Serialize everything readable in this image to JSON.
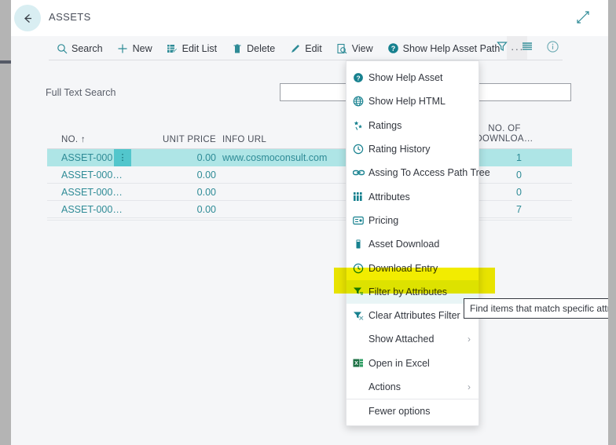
{
  "window": {
    "back_icon": "back-arrow-icon",
    "title": "ASSETS",
    "expand_icon": "expand-diagonal-icon"
  },
  "toolbar": {
    "items": [
      {
        "label": "Search",
        "icon": "search-icon"
      },
      {
        "label": "New",
        "icon": "plus-icon"
      },
      {
        "label": "Edit List",
        "icon": "edit-list-icon"
      },
      {
        "label": "Delete",
        "icon": "trash-icon"
      },
      {
        "label": "Edit",
        "icon": "pencil-icon"
      },
      {
        "label": "View",
        "icon": "view-page-icon"
      },
      {
        "label": "Show Help Asset Path",
        "icon": "help-circle-icon"
      }
    ],
    "ellipsis_label": "···",
    "right_icons": [
      {
        "name": "filter-funnel-icon"
      },
      {
        "name": "list-lines-icon"
      },
      {
        "name": "info-circle-icon"
      }
    ]
  },
  "filter_pane": {
    "full_text_search_label": "Full Text Search",
    "full_text_search_value": "",
    "full_text_search_placeholder": ""
  },
  "grid": {
    "columns": [
      {
        "key": "no",
        "label": "NO. ↑"
      },
      {
        "key": "price",
        "label": "UNIT PRICE"
      },
      {
        "key": "url",
        "label": "INFO URL"
      },
      {
        "key": "dl",
        "label": "NO. OF",
        "label2": "DOWNLOA…"
      }
    ],
    "rows": [
      {
        "no": "ASSET-000…",
        "price": "0.00",
        "url": "www.cosmoconsult.com",
        "dl": "1",
        "selected": true
      },
      {
        "no": "ASSET-000…",
        "price": "0.00",
        "url": "",
        "dl": "0",
        "selected": false
      },
      {
        "no": "ASSET-000…",
        "price": "0.00",
        "url": "",
        "dl": "0",
        "selected": false
      },
      {
        "no": "ASSET-000…",
        "price": "0.00",
        "url": "",
        "dl": "7",
        "selected": false
      }
    ],
    "row_menu_label": "⋮"
  },
  "menu": {
    "items": [
      {
        "label": "Show Help Asset",
        "icon": "help-circle-icon",
        "submenu": false,
        "hovered": false
      },
      {
        "label": "Show Help HTML",
        "icon": "globe-icon",
        "submenu": false,
        "hovered": false
      },
      {
        "label": "Ratings",
        "icon": "ratings-stars-icon",
        "submenu": false,
        "hovered": false
      },
      {
        "label": "Rating History",
        "icon": "clock-history-icon",
        "submenu": false,
        "hovered": false
      },
      {
        "label": "Assing To Access Path Tree",
        "icon": "link-chain-icon",
        "submenu": false,
        "hovered": false
      },
      {
        "label": "Attributes",
        "icon": "attributes-grid-icon",
        "submenu": false,
        "hovered": false
      },
      {
        "label": "Pricing",
        "icon": "pricing-tag-icon",
        "submenu": false,
        "hovered": false
      },
      {
        "label": "Asset Download",
        "icon": "download-box-icon",
        "submenu": false,
        "hovered": false
      },
      {
        "label": "Download Entry",
        "icon": "clock-history-icon",
        "submenu": false,
        "hovered": false
      },
      {
        "label": "Filter by Attributes",
        "icon": "filter-funnel-icon",
        "submenu": false,
        "hovered": true
      },
      {
        "label": "Clear Attributes Filter",
        "icon": "clear-filter-icon",
        "submenu": false,
        "hovered": false
      },
      {
        "label": "Show Attached",
        "icon": "",
        "submenu": true,
        "hovered": false
      },
      {
        "label": "Open in Excel",
        "icon": "excel-icon",
        "submenu": false,
        "hovered": false
      },
      {
        "label": "Actions",
        "icon": "",
        "submenu": true,
        "hovered": false
      },
      {
        "label": "Fewer options",
        "icon": "",
        "submenu": false,
        "hovered": false
      }
    ],
    "submenu_chevron": "›"
  },
  "tooltip": {
    "text": "Find items that match specific attrib"
  },
  "highlight": {
    "color": "#f2ec00"
  },
  "colors": {
    "accent": "#2e8b96",
    "selected_row": "#aee5e6",
    "highlight_yellow": "#f2ec00",
    "page_bg": "#f5f6f8"
  }
}
